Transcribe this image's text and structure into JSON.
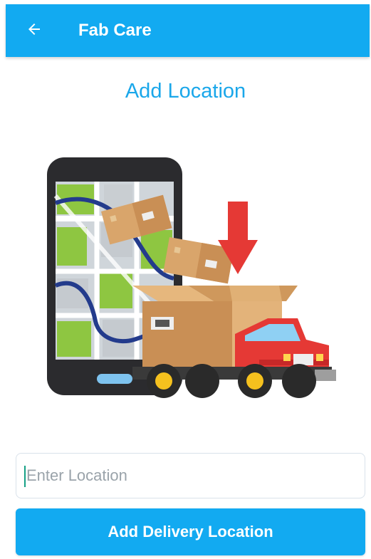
{
  "header": {
    "app_title": "Fab Care",
    "back_icon": "arrow-left-icon",
    "color": "#12aaf1"
  },
  "main": {
    "heading": "Add Location",
    "heading_color": "#1aa7ea",
    "illustration_icon": "delivery-truck-phone-map-illustration"
  },
  "form": {
    "location_placeholder": "Enter Location",
    "location_value": "",
    "submit_label": "Add Delivery Location",
    "button_color": "#12aaf1"
  }
}
